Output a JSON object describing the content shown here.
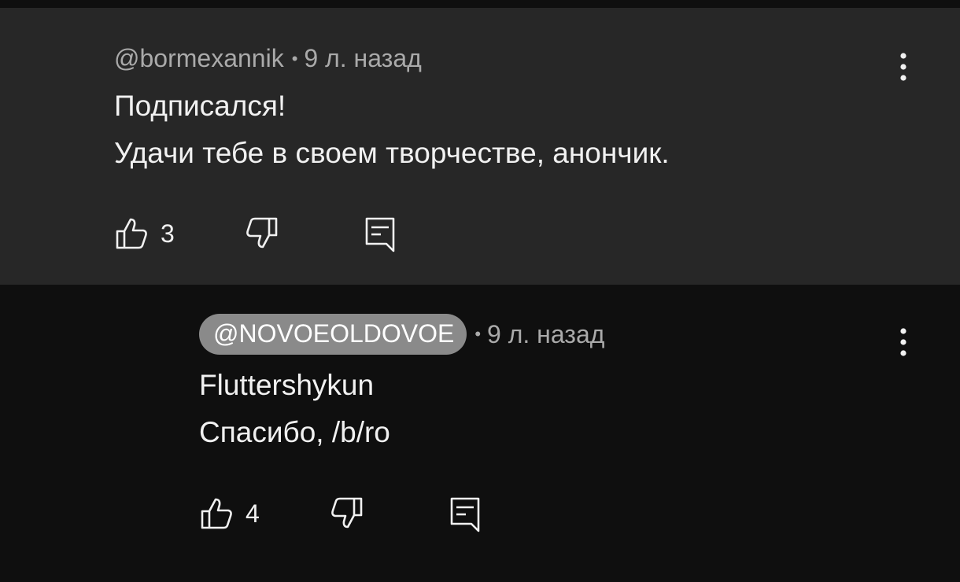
{
  "comments": [
    {
      "author": "@bormexannik",
      "separator": "•",
      "time": "9 л. назад",
      "lines": [
        "Подписался!",
        "Удачи тебе в своем творчестве, анончик."
      ],
      "likes": "3"
    },
    {
      "author": "@NOVOEOLDOVOE",
      "separator": "•",
      "time": "9 л. назад",
      "lines": [
        "Fluttershykun",
        "Спасибо, /b/ro"
      ],
      "likes": "4"
    }
  ],
  "icons": {
    "like": "thumbs-up-icon",
    "dislike": "thumbs-down-icon",
    "reply": "reply-comment-icon",
    "menu": "more-vert-icon"
  },
  "colors": {
    "top_bg": "#272727",
    "reply_bg": "#0f0f0f",
    "text": "#f1f1f1",
    "meta": "#aaaaaa",
    "chip": "#8a8a8a"
  }
}
